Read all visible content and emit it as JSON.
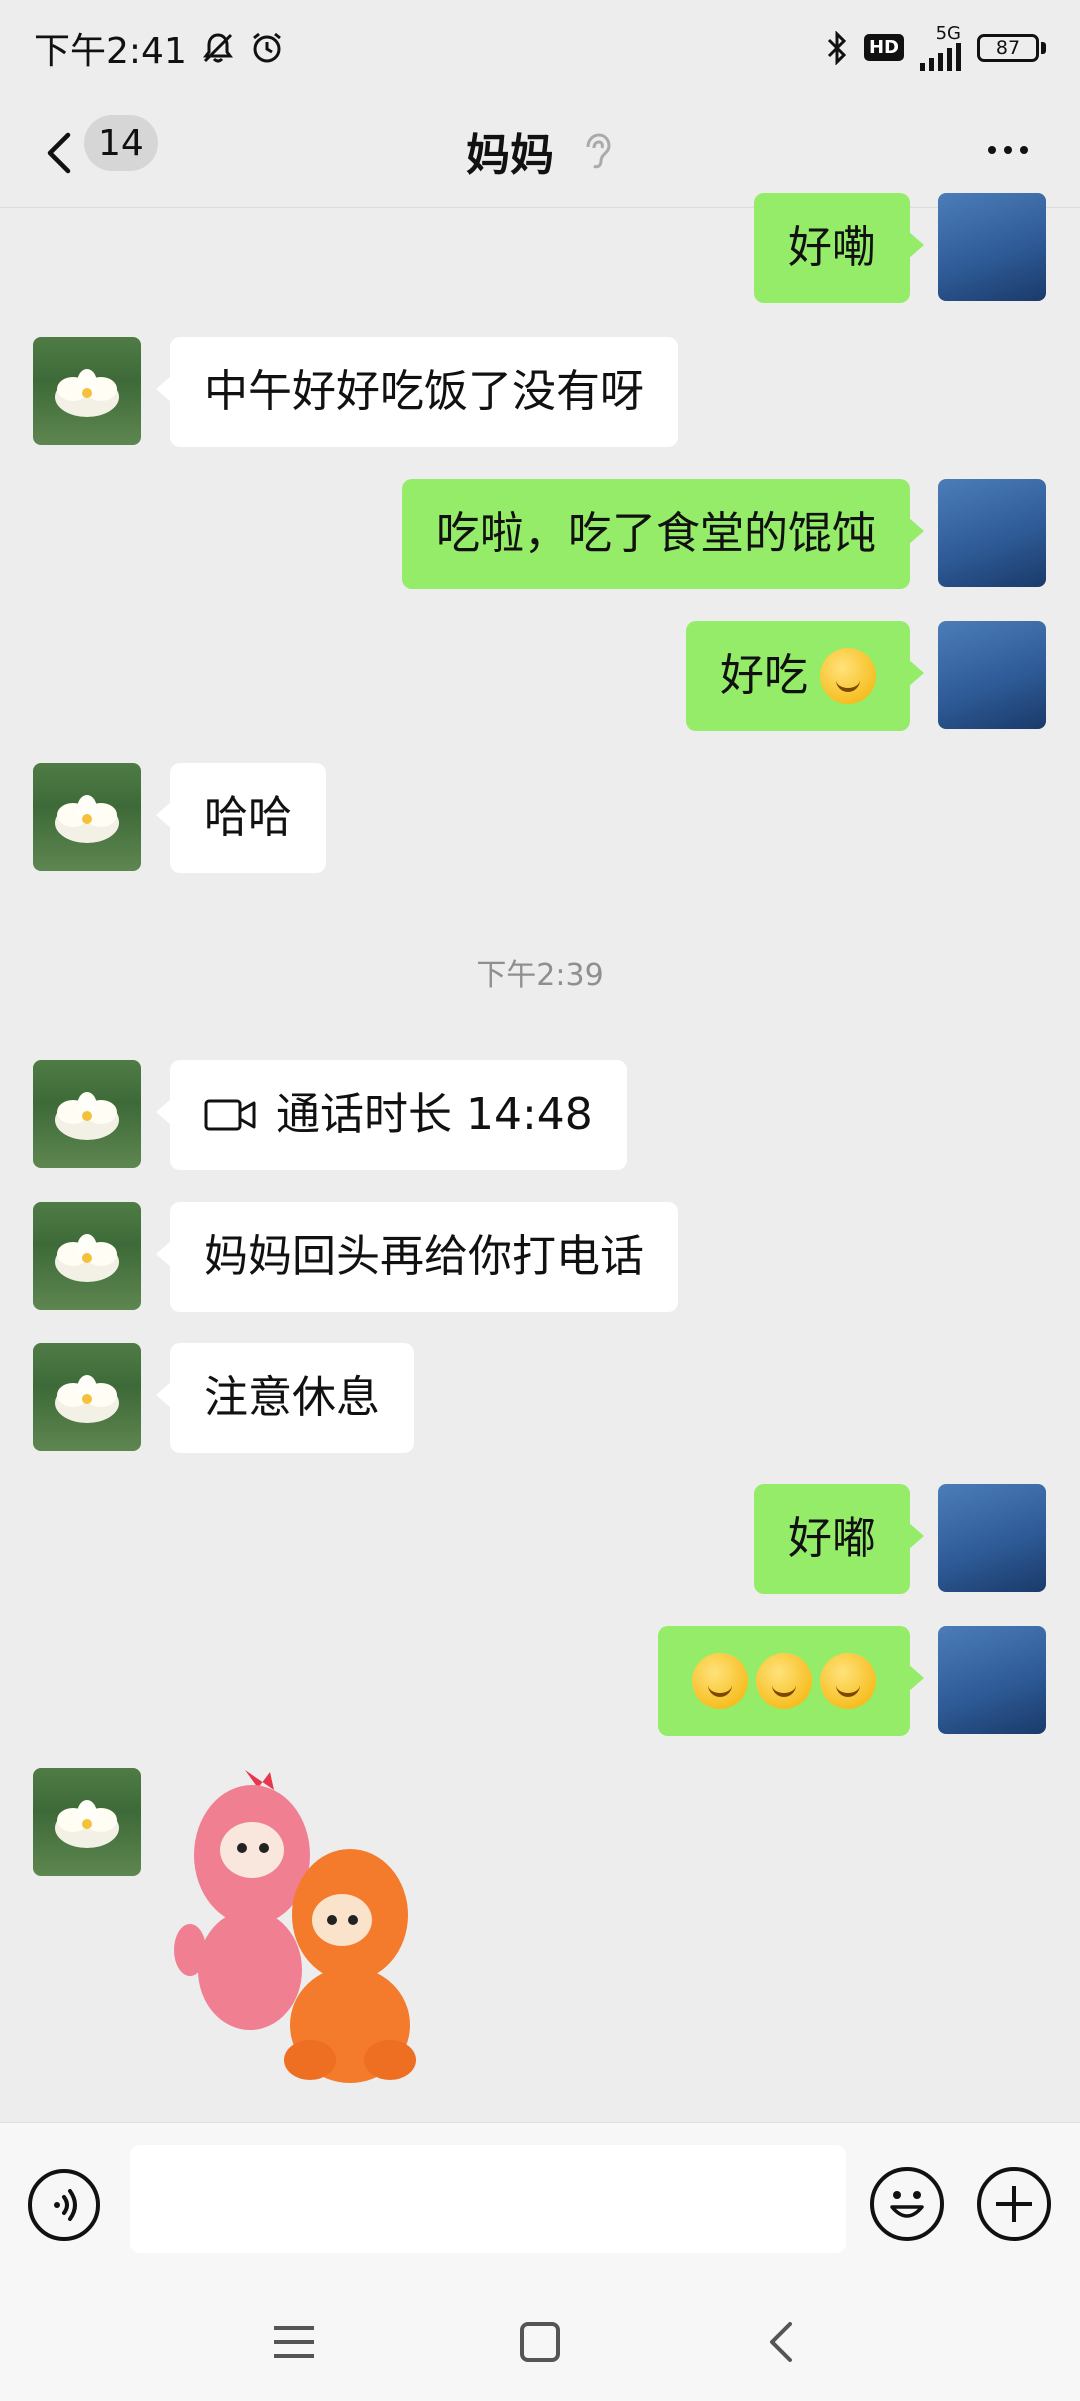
{
  "status_bar": {
    "time": "下午2:41",
    "network": "5G",
    "hd": "HD",
    "battery": "87",
    "icons": [
      "mute-icon",
      "alarm-icon",
      "bluetooth-icon",
      "hd-icon",
      "signal-icon",
      "battery-icon"
    ]
  },
  "header": {
    "back_count": "14",
    "title": "妈妈",
    "title_icon": "ear-icon",
    "more_icon": "more-icon"
  },
  "messages": [
    {
      "side": "right",
      "text": "好嘞"
    },
    {
      "side": "left",
      "text": "中午好好吃饭了没有呀"
    },
    {
      "side": "right",
      "text": "吃啦，吃了食堂的馄饨"
    },
    {
      "side": "right",
      "text": "好吃",
      "emoji": "yum-emoji"
    },
    {
      "side": "left",
      "text": "哈哈"
    },
    {
      "type": "timestamp",
      "text": "下午2:39"
    },
    {
      "side": "left",
      "text": "通话时长 14:48",
      "icon": "video-call-icon"
    },
    {
      "side": "left",
      "text": "妈妈回头再给你打电话"
    },
    {
      "side": "left",
      "text": "注意休息"
    },
    {
      "side": "right",
      "text": "好嘟"
    },
    {
      "side": "right",
      "emoji": "kissing-emoji"
    },
    {
      "side": "left",
      "sticker": "monkeys-hug-sticker"
    }
  ],
  "input_bar": {
    "voice_icon": "voice-icon",
    "emoji_icon": "emoji-icon",
    "plus_icon": "plus-icon"
  },
  "nav_bar": {
    "icons": [
      "menu-icon",
      "home-icon",
      "back-icon"
    ]
  },
  "colors": {
    "background": "#EDEDED",
    "sent_bubble": "#95EC69",
    "received_bubble": "#FFFFFF"
  }
}
